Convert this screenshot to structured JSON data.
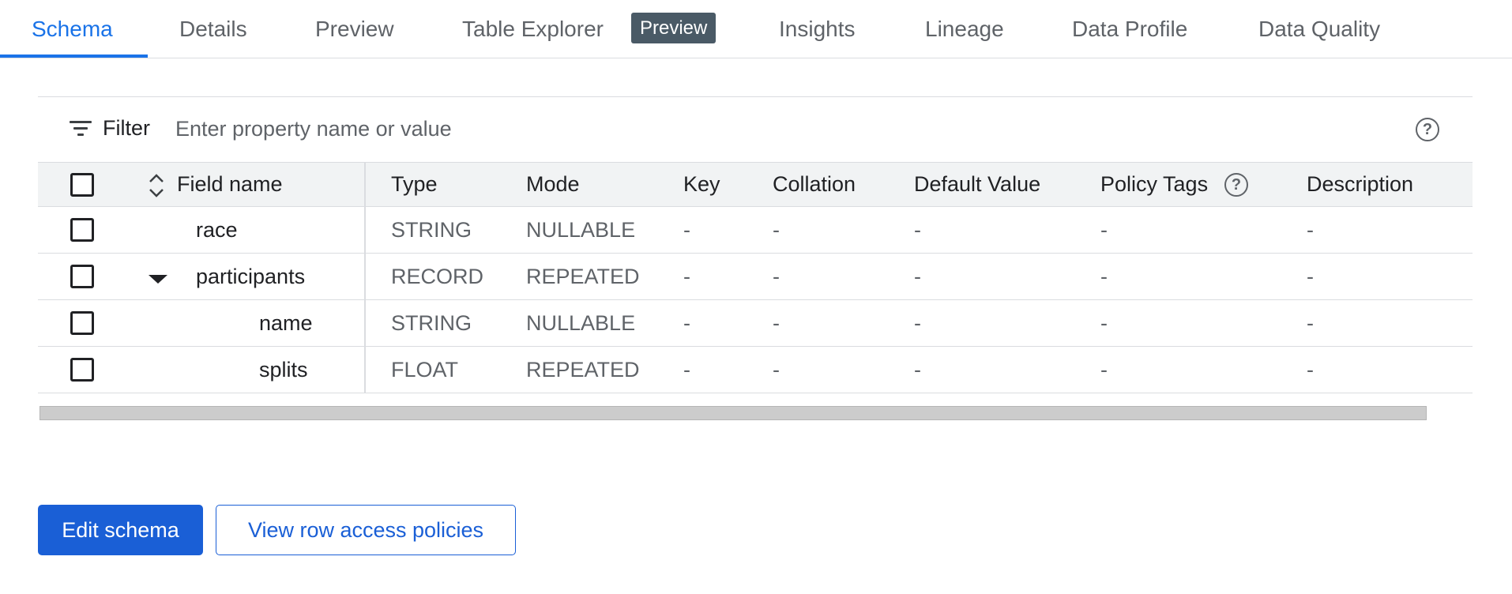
{
  "tabs": [
    {
      "label": "Schema",
      "active": true
    },
    {
      "label": "Details"
    },
    {
      "label": "Preview"
    },
    {
      "label": "Table Explorer",
      "badge": "Preview"
    },
    {
      "label": "Insights"
    },
    {
      "label": "Lineage"
    },
    {
      "label": "Data Profile"
    },
    {
      "label": "Data Quality"
    }
  ],
  "filter": {
    "label": "Filter",
    "placeholder": "Enter property name or value",
    "help": "?"
  },
  "table": {
    "headers": {
      "field_name": "Field name",
      "type": "Type",
      "mode": "Mode",
      "key": "Key",
      "collation": "Collation",
      "default_value": "Default Value",
      "policy_tags": "Policy Tags",
      "policy_tags_help": "?",
      "description": "Description"
    },
    "rows": [
      {
        "name": "race",
        "type": "STRING",
        "mode": "NULLABLE",
        "key": "-",
        "collation": "-",
        "default_value": "-",
        "policy_tags": "-",
        "description": "-"
      },
      {
        "name": "participants",
        "type": "RECORD",
        "mode": "REPEATED",
        "key": "-",
        "collation": "-",
        "default_value": "-",
        "policy_tags": "-",
        "description": "-",
        "expanded": true
      },
      {
        "name": "name",
        "type": "STRING",
        "mode": "NULLABLE",
        "key": "-",
        "collation": "-",
        "default_value": "-",
        "policy_tags": "-",
        "description": "-"
      },
      {
        "name": "splits",
        "type": "FLOAT",
        "mode": "REPEATED",
        "key": "-",
        "collation": "-",
        "default_value": "-",
        "policy_tags": "-",
        "description": "-"
      }
    ]
  },
  "buttons": {
    "edit_schema": "Edit schema",
    "view_row_access": "View row access policies"
  },
  "colors": {
    "accent": "#1a73e8",
    "primary_button": "#1a5fd6",
    "badge_bg": "#4a5a66",
    "header_bg": "#f1f3f4"
  }
}
